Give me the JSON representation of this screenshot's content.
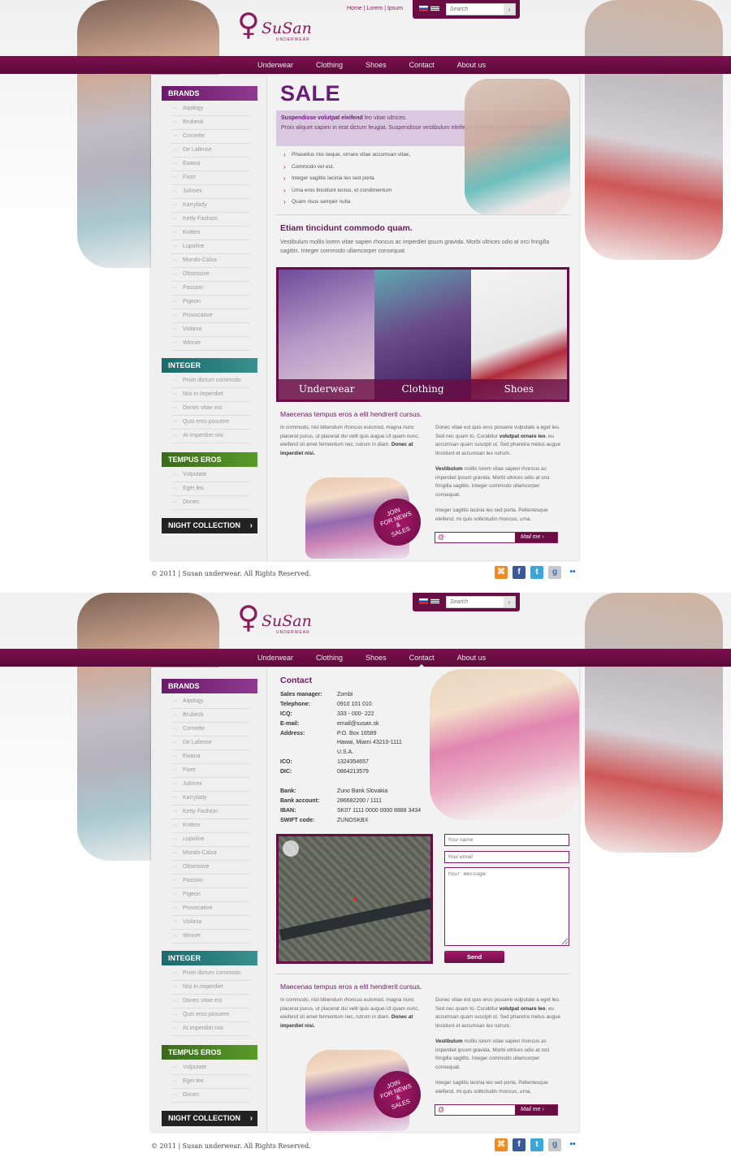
{
  "header": {
    "logo_text": "SuSan",
    "logo_sub": "UNDERWEAR",
    "top_links": [
      "Home",
      "Lorem",
      "Ipsum"
    ],
    "search_placeholder": "Search",
    "search_icon": "chevron-right-icon"
  },
  "nav": {
    "items": [
      "Underwear",
      "Clothing",
      "Shoes",
      "Contact",
      "About us"
    ]
  },
  "sidebar": {
    "brands_title": "BRANDS",
    "brands": [
      "Aqalogy",
      "Brubeck",
      "Cornette",
      "De Lafense",
      "Ewana",
      "Fiore",
      "Julimex",
      "Karrylady",
      "Ketty Fashion",
      "Knittex",
      "Lupoline",
      "Mondo-Calza",
      "Obsessive",
      "Passion",
      "Pigeon",
      "Provocative",
      "Violana",
      "Winner"
    ],
    "integer_title": "INTEGER",
    "integer_items": [
      "Proin dictum commodo",
      "Nisi in imperdiet",
      "Donec vitae est",
      "Quis eros posuere",
      "At imperdiet nisi"
    ],
    "tempus_title": "TEMPUS EROS",
    "tempus_items": [
      "Vulputate",
      "Eget leo",
      "Donec"
    ],
    "night_label": "NIGHT COLLECTION"
  },
  "home": {
    "sale_title": "SALE",
    "sale_lead_bold": "Suspendisse volutpat eleifend",
    "sale_lead_rest": " leo vitae ultrices.",
    "sale_text": "Proin aliquet sapien in erat dictum feugiat. Suspendisse vestibulum eleifend dapibus. Suspendisse potenti.",
    "bullets": [
      "Phasellus nisi neque, ornare vitae accumsan vitae,",
      "Commodo vel est.",
      "Integer sagittis lacinia leo sed porta",
      "Urna eros tincidunt luctus, et condimentum",
      "Quam risus semper nulla."
    ],
    "etiam_title": "Etiam tincidunt commodo quam.",
    "etiam_text": "Vestibulum mollis lorem vitae sapien rhoncus ac imperdiet ipsum gravida. Morbi ultrices odio at orci fringilla sagittis. Integer commodo ullamcorper consequat.",
    "gallery": [
      "Underwear",
      "Clothing",
      "Shoes"
    ]
  },
  "shared": {
    "maecenas_title": "Maecenas tempus eros a elit hendrerit cursus.",
    "left_text": "In commodo, nisl bibendum rhoncus euismod, magna nunc placerat purus, ut placerat dui velit quis augue.Ut quam nunc, eleifend sit amet fermentum nec, rutrum in diam.",
    "left_bold": "Donec at imperdiet nisi.",
    "right_p1_pre": "Donec vitae est quis eros posuere vulputate a eget leo. Sed nec quam to. Curabitur ",
    "right_p1_bold": "volutpat ornare leo",
    "right_p1_post": ", eu accumsan quam suscipit ut. Sed pharetra metus augue tincidunt et accumsan leo rutrum.",
    "right_p2_bold": "Vestibulum",
    "right_p2_rest": " mollis lorem vitae sapien rhoncus ac imperdiet ipsum gravida. Morbi ultrices odio at orci fringilla sagittis. Integer commodo ullamcorper consequat.",
    "right_p3": "Integer sagittis lacinia leo sed porta. Pellentesque eleifend, mi quis sollicitudin rhoncus, urna.",
    "promo_line1": "JOIN",
    "promo_line2": "FOR NEWS",
    "promo_line3": "&",
    "promo_line4": "SALES",
    "newsletter_at": "@",
    "newsletter_btn": "Mail me"
  },
  "contact": {
    "title": "Contact",
    "rows": [
      {
        "label": "Sales manager:",
        "value": "Zombi"
      },
      {
        "label": "Telephone:",
        "value": "0910 101 010"
      },
      {
        "label": "ICQ:",
        "value": "333 - 000- 222"
      },
      {
        "label": "E-mail:",
        "value": "email@susan.sk"
      },
      {
        "label": "Address:",
        "value": "P.O. Box 16589"
      },
      {
        "label": "",
        "value": "Hawai, Miami 43210-1111"
      },
      {
        "label": "",
        "value": "U.S.A."
      },
      {
        "label": "ICO:",
        "value": "1324354657"
      },
      {
        "label": "DIC:",
        "value": "0864213579"
      },
      {
        "label": "",
        "value": ""
      },
      {
        "label": "Bank:",
        "value": "Zuno Bank Slovakia"
      },
      {
        "label": "Bank account:",
        "value": "286682200 / 1111"
      },
      {
        "label": "IBAN:",
        "value": "SK07 1111 0000 0000 8888 3434"
      },
      {
        "label": "SWIFT code:",
        "value": "ZUNOSKBX"
      }
    ],
    "name_placeholder": "Your name",
    "email_placeholder": "Your email",
    "message_placeholder": "Your message",
    "send_label": "Send"
  },
  "footer": {
    "copyright": "© 2011  |  Susan underwear. All Rights Reserved.",
    "social": [
      "rss-icon",
      "facebook-icon",
      "twitter-icon",
      "google-icon",
      "flickr-icon"
    ]
  },
  "colors": {
    "brand": "#6a0d45",
    "accent_purple": "#6a1a7a",
    "integer_teal": "#1a6a6a",
    "tempus_green": "#3a6a1a"
  }
}
